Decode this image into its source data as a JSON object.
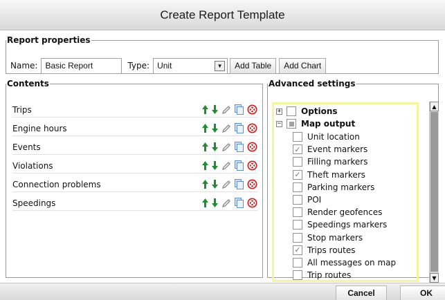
{
  "window": {
    "title": "Create Report Template"
  },
  "report_properties": {
    "legend": "Report properties",
    "name_label": "Name:",
    "name_value": "Basic Report",
    "type_label": "Type:",
    "type_value": "Unit",
    "add_table_label": "Add Table",
    "add_chart_label": "Add Chart"
  },
  "contents": {
    "legend": "Contents",
    "items": [
      {
        "label": "Trips"
      },
      {
        "label": "Engine hours"
      },
      {
        "label": "Events"
      },
      {
        "label": "Violations"
      },
      {
        "label": "Connection problems"
      },
      {
        "label": "Speedings"
      }
    ],
    "icons": [
      "move-up-icon",
      "move-down-icon",
      "edit-icon",
      "copy-icon",
      "delete-icon"
    ]
  },
  "advanced": {
    "legend": "Advanced settings",
    "options": {
      "label": "Options",
      "expander": "+",
      "checked": false
    },
    "map_output": {
      "label": "Map output",
      "expander": "−",
      "state": "partial"
    },
    "items": [
      {
        "label": "Unit location",
        "checked": false
      },
      {
        "label": "Event markers",
        "checked": true
      },
      {
        "label": "Filling markers",
        "checked": false
      },
      {
        "label": "Theft markers",
        "checked": true
      },
      {
        "label": "Parking markers",
        "checked": false
      },
      {
        "label": "POI",
        "checked": false
      },
      {
        "label": "Render geofences",
        "checked": false
      },
      {
        "label": "Speedings markers",
        "checked": false
      },
      {
        "label": "Stop markers",
        "checked": false
      },
      {
        "label": "Trips routes",
        "checked": true
      },
      {
        "label": "All messages on map",
        "checked": false
      },
      {
        "label": "Trip routes",
        "checked": false
      }
    ]
  },
  "footer": {
    "cancel_label": "Cancel",
    "ok_label": "OK"
  },
  "colors": {
    "arrow_green": "#1e8f2e",
    "delete_red": "#d62020",
    "highlight_yellow": "#f5f59a"
  }
}
